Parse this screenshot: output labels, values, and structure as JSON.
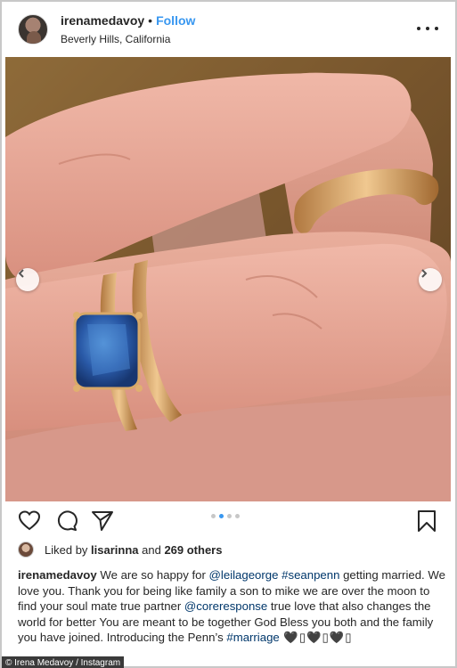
{
  "post": {
    "username": "irenamedavoy",
    "separator": "•",
    "follow_label": "Follow",
    "location": "Beverly Hills, California",
    "more_icon": "more-horizontal-icon"
  },
  "carousel": {
    "total_slides": 4,
    "active_index": 2
  },
  "actions": {
    "icons": [
      "heart-icon",
      "comment-icon",
      "share-icon",
      "bookmark-icon"
    ]
  },
  "likes": {
    "prefix": "Liked by ",
    "user": "lisarinna",
    "middle": " and ",
    "others": "269 others"
  },
  "caption": {
    "username": "irenamedavoy",
    "part1": " We are so happy for ",
    "mention1": "@leilageorge",
    "space1": " ",
    "hashtag1": "#seanpenn",
    "part2": " getting married. We love you. Thank you for being like family a son to mike we are over the moon to find your soul mate true partner ",
    "mention2": "@coreresponse",
    "part3": " true love that also changes the world for better You are meant to be together God Bless you both and the family you have joined. Introducing the Penn’s ",
    "hashtag2": "#marriage",
    "emojis": " 🖤▯🖤▯🖤▯"
  },
  "credit": {
    "text": "© Irena Medavoy / Instagram"
  },
  "colors": {
    "follow": "#3897f0",
    "link": "#00376b",
    "dot_active": "#3897f0",
    "dot_inactive": "#c7c7c7",
    "text": "#262626"
  }
}
